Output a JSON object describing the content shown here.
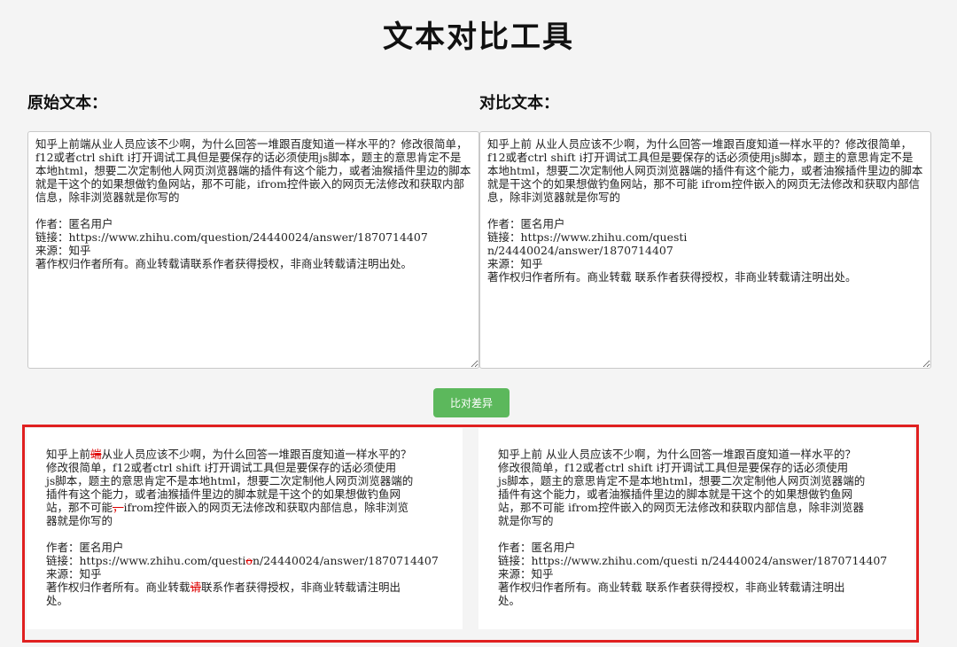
{
  "page": {
    "title": "文本对比工具",
    "original_label": "原始文本：",
    "compare_label": "对比文本：",
    "compare_button": "比对差异"
  },
  "original_text": "知乎上前端从业人员应该不少啊，为什么回答一堆跟百度知道一样水平的？修改很简单，f12或者ctrl shift i打开调试工具但是要保存的话必须使用js脚本，题主的意思肯定不是本地html，想要二次定制他人网页浏览器端的插件有这个能力，或者油猴插件里边的脚本就是干这个的如果想做钓鱼网站，那不可能，ifrom控件嵌入的网页无法修改和获取内部信息，除非浏览器就是你写的\n\n作者：匿名用户\n链接：https://www.zhihu.com/question/24440024/answer/1870714407\n来源：知乎\n著作权归作者所有。商业转载请联系作者获得授权，非商业转载请注明出处。",
  "compare_text": "知乎上前 从业人员应该不少啊，为什么回答一堆跟百度知道一样水平的？修改很简单，f12或者ctrl shift i打开调试工具但是要保存的话必须使用js脚本，题主的意思肯定不是本地html，想要二次定制他人网页浏览器端的插件有这个能力，或者油猴插件里边的脚本就是干这个的如果想做钓鱼网站，那不可能 ifrom控件嵌入的网页无法修改和获取内部信息，除非浏览器就是你写的\n\n作者：匿名用户\n链接：https://www.zhihu.com/questi\nn/24440024/answer/1870714407\n来源：知乎\n著作权归作者所有。商业转载 联系作者获得授权，非商业转载请注明出处。",
  "result_left": {
    "seg1": "知乎上前",
    "del1": "端",
    "seg2": "从业人员应该不少啊，为什么回答一堆跟百度知道一样水平的？\n修改很简单，f12或者ctrl shift i打开调试工具但是要保存的话必须使用\njs脚本，题主的意思肯定不是本地html，想要二次定制他人网页浏览器端的\n插件有这个能力，或者油猴插件里边的脚本就是干这个的如果想做钓鱼网\n站，那不可能",
    "del2": "，",
    "seg3": "ifrom控件嵌入的网页无法修改和获取内部信息，除非浏览\n器就是你写的\n\n作者：匿名用户\n链接：https://www.zhihu.com/questi",
    "del3": "o",
    "seg4": "n/24440024/answer/1870714407\n来源：知乎\n著作权归作者所有。商业转载",
    "del4": "请",
    "seg5": "联系作者获得授权，非商业转载请注明出\n处。"
  },
  "result_right": {
    "text": "知乎上前 从业人员应该不少啊，为什么回答一堆跟百度知道一样水平的？\n修改很简单，f12或者ctrl shift i打开调试工具但是要保存的话必须使用\njs脚本，题主的意思肯定不是本地html，想要二次定制他人网页浏览器端的\n插件有这个能力，或者油猴插件里边的脚本就是干这个的如果想做钓鱼网\n站，那不可能 ifrom控件嵌入的网页无法修改和获取内部信息，除非浏览器\n就是你写的\n\n作者：匿名用户\n链接：https://www.zhihu.com/questi n/24440024/answer/1870714407\n来源：知乎\n著作权归作者所有。商业转载 联系作者获得授权，非商业转载请注明出\n处。"
  },
  "colors": {
    "accent_button": "#5cb85c",
    "highlight_border": "#e02020",
    "diff_removed": "#dd0000"
  }
}
